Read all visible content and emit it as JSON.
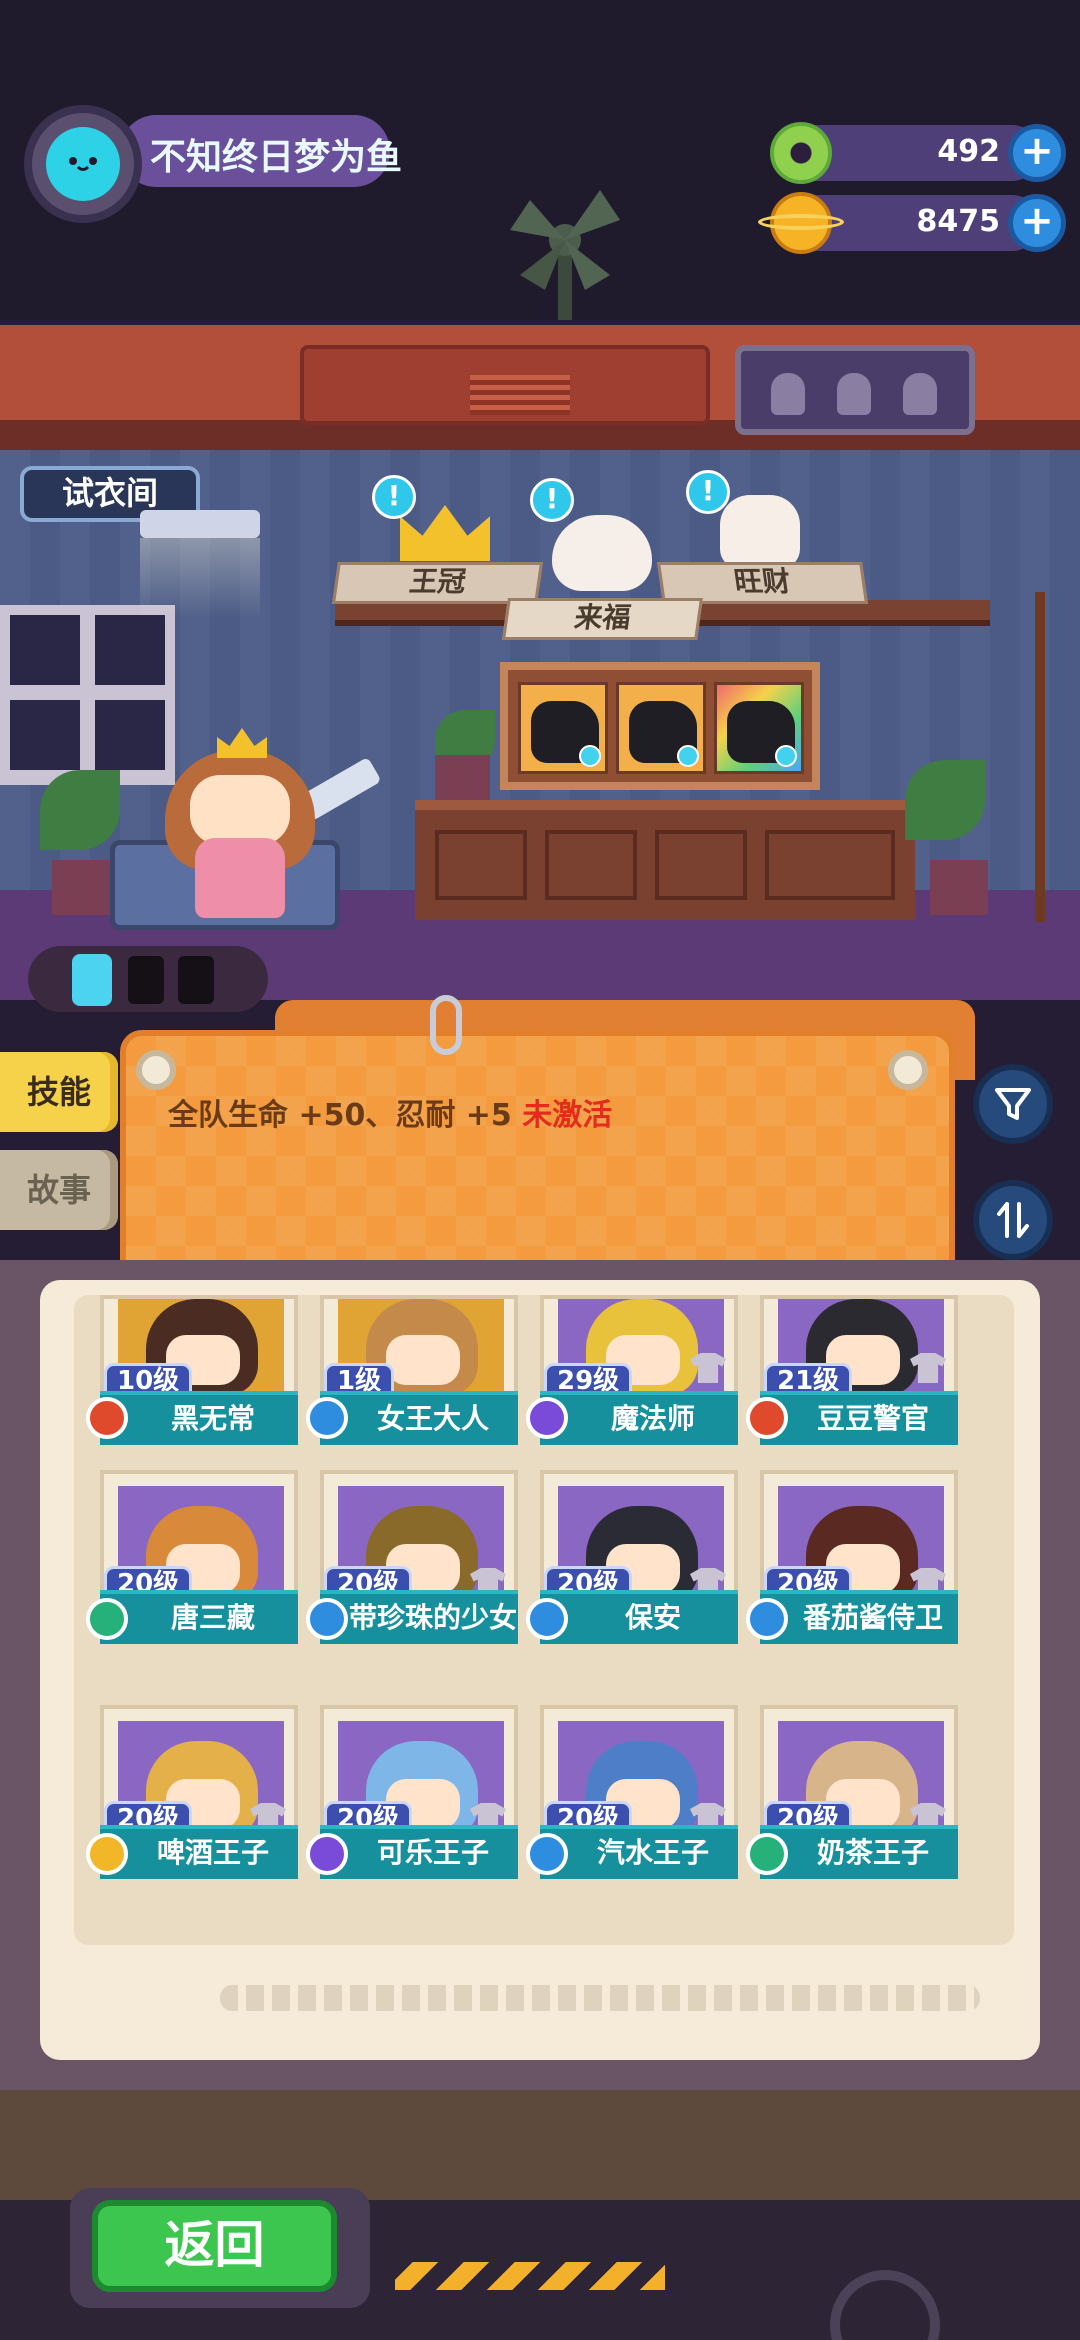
{
  "profile": {
    "username": "不知终日梦为鱼",
    "avatar_icon": "cat-face-icon"
  },
  "currency": {
    "green_donut": {
      "value": "492",
      "icon": "donut-icon",
      "plus": "+"
    },
    "gold_planet": {
      "value": "8475",
      "icon": "planet-coin-icon",
      "plus": "+"
    }
  },
  "room": {
    "fitting_room_label": "试衣间",
    "pets": [
      {
        "name": "王冠",
        "alert": "!"
      },
      {
        "name": "来福",
        "alert": "!"
      },
      {
        "name": "旺财",
        "alert": "!"
      }
    ]
  },
  "skill_panel": {
    "text": "全队生命 +50、忍耐 +5",
    "status": "未激活"
  },
  "tabs": {
    "skill": "技能",
    "story": "故事"
  },
  "controls": {
    "filter_icon": "filter-icon",
    "sort_icon": "sort-icon"
  },
  "characters": [
    {
      "level": "10级",
      "name": "黑无常",
      "badge": "red"
    },
    {
      "level": "1级",
      "name": "女王大人",
      "badge": "blue"
    },
    {
      "level": "29级",
      "name": "魔法师",
      "badge": "purple"
    },
    {
      "level": "21级",
      "name": "豆豆警官",
      "badge": "red"
    },
    {
      "level": "20级",
      "name": "唐三藏",
      "badge": "green"
    },
    {
      "level": "20级",
      "name": "带珍珠的少女",
      "badge": "blue"
    },
    {
      "level": "20级",
      "name": "保安",
      "badge": "blue"
    },
    {
      "level": "20级",
      "name": "番茄酱侍卫",
      "badge": "blue"
    },
    {
      "level": "20级",
      "name": "啤酒王子",
      "badge": "yellow"
    },
    {
      "level": "20级",
      "name": "可乐王子",
      "badge": "purple"
    },
    {
      "level": "20级",
      "name": "汽水王子",
      "badge": "blue"
    },
    {
      "level": "20级",
      "name": "奶茶王子",
      "badge": "green"
    }
  ],
  "bottom": {
    "back_label": "返回"
  },
  "colors": {
    "accent_teal": "#17909e",
    "board_orange": "#f39b3e",
    "inactive_red": "#e42b1c",
    "back_green": "#3cc64f"
  }
}
